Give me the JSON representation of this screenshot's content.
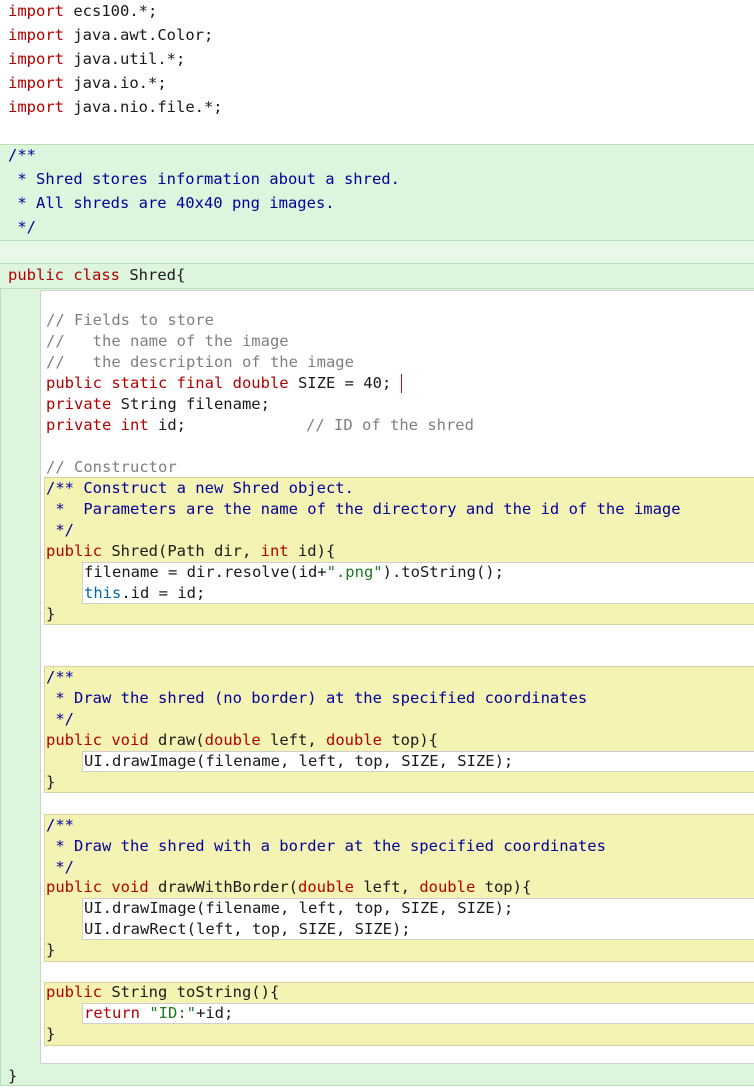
{
  "editor": {
    "imports": [
      {
        "kw": "import",
        "rest": " ecs100.*;"
      },
      {
        "kw": "import",
        "rest": " java.awt.Color;"
      },
      {
        "kw": "import",
        "rest": " java.util.*;"
      },
      {
        "kw": "import",
        "rest": " java.io.*;"
      },
      {
        "kw": "import",
        "rest": " java.nio.file.*;"
      }
    ],
    "class_doc": [
      "/**",
      " * Shred stores information about a shred.",
      " * All shreds are 40x40 png images.",
      " */"
    ],
    "class_decl": {
      "kw1": "public",
      "kw2": " class",
      "name": " Shred{"
    },
    "fields_comment": [
      "// Fields to store",
      "//   the name of the image",
      "//   the description of the image"
    ],
    "size_field": {
      "kw": "public static final",
      "type": " double",
      "rest": " SIZE = 40;"
    },
    "filename_field": {
      "kw": "private",
      "rest": " String filename;"
    },
    "id_field": {
      "kw": "private",
      "type": " int",
      "rest": " id;",
      "comment": "// ID of the shred"
    },
    "constructor_comment": "// Constructor",
    "constructor_doc": [
      "/** Construct a new Shred object.",
      " *  Parameters are the name of the directory and the id of the image",
      " */"
    ],
    "constructor_sig": {
      "kw": "public",
      "a": " Shred(Path dir, ",
      "type": "int",
      "b": " id){"
    },
    "constructor_body1": {
      "a": "filename = dir.resolve(id+",
      "str": "\".png\"",
      "b": ").toString();"
    },
    "constructor_body2": {
      "kw": "this",
      "rest": ".id = id;"
    },
    "close_brace": "}",
    "draw_doc": [
      "/**",
      " * Draw the shred (no border) at the specified coordinates",
      " */"
    ],
    "draw_sig": {
      "kw": "public",
      "type": " void",
      "a": " draw(",
      "t1": "double",
      "b": " left, ",
      "t2": "double",
      "c": " top){"
    },
    "draw_body": "UI.drawImage(filename, left, top, SIZE, SIZE);",
    "drawb_doc": [
      "/**",
      " * Draw the shred with a border at the specified coordinates",
      " */"
    ],
    "drawb_sig": {
      "kw": "public",
      "type": " void",
      "a": " drawWithBorder(",
      "t1": "double",
      "b": " left, ",
      "t2": "double",
      "c": " top){"
    },
    "drawb_body1": "UI.drawImage(filename, left, top, SIZE, SIZE);",
    "drawb_body2": "UI.drawRect(left, top, SIZE, SIZE);",
    "tostring_sig": {
      "kw": "public",
      "a": " String toString(){"
    },
    "tostring_body": {
      "kw": "return",
      "str": " \"ID:\"",
      "b": "+id;"
    },
    "class_close": "}"
  },
  "colors": {
    "keyword": "#b30000",
    "doc_comment": "#00009a",
    "comment": "#7f7f7f",
    "string": "#1d7a1d",
    "class_bg": "#dcf5dc",
    "method_bg": "#f5f3b3"
  }
}
